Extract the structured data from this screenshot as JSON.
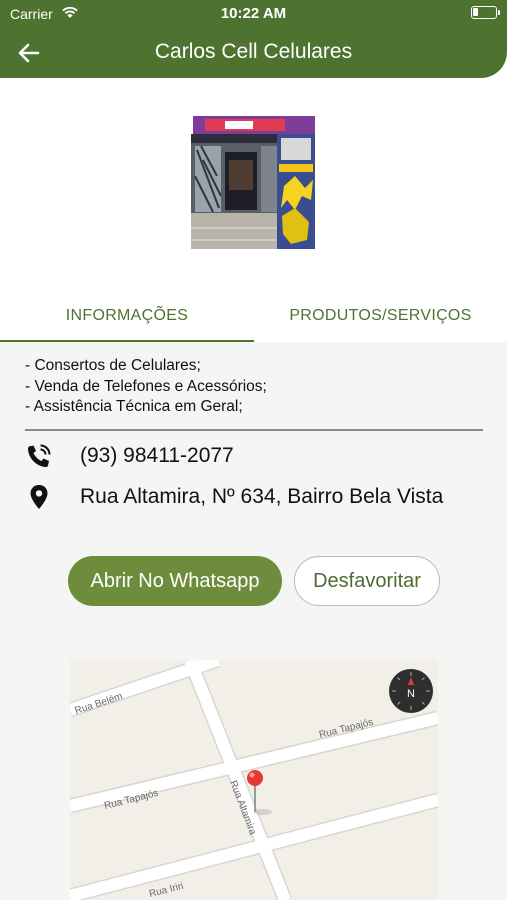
{
  "status_bar": {
    "carrier": "Carrier",
    "time": "10:22 AM"
  },
  "header": {
    "title": "Carlos Cell Celulares"
  },
  "tabs": [
    {
      "label": "INFORMAÇÕES",
      "active": true
    },
    {
      "label": "PRODUTOS/SERVIÇOS",
      "active": false
    }
  ],
  "services": [
    "- Consertos de Celulares;",
    "- Venda de Telefones e Acessórios;",
    "- Assistência Técnica em Geral;"
  ],
  "contact": {
    "phone": "(93) 98411-2077",
    "address": "Rua Altamira, Nº 634, Bairro Bela Vista"
  },
  "buttons": {
    "whatsapp": "Abrir No Whatsapp",
    "unfavorite": "Desfavoritar"
  },
  "map": {
    "streets": [
      "Rua Belém",
      "Rua Tapajós",
      "Rua Tapajós",
      "Rua Altamira",
      "Rua Iriri"
    ],
    "compass_label": "N"
  },
  "colors": {
    "primary": "#4e7330",
    "button": "#6e8d3c",
    "background": "#f5f5f4"
  }
}
